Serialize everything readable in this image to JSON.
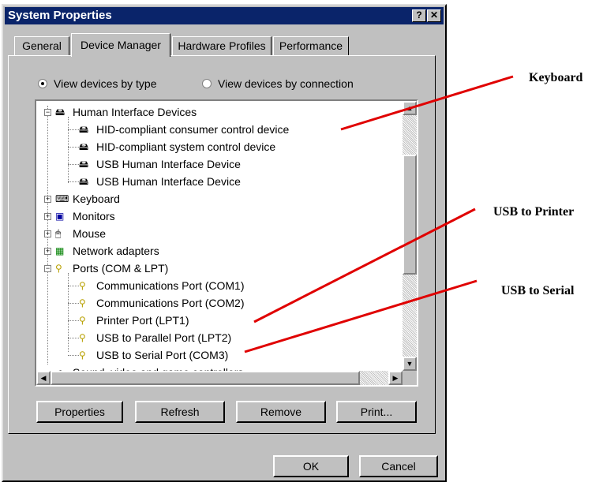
{
  "window": {
    "title": "System Properties",
    "help_label": "?",
    "close_label": "✕"
  },
  "tabs": [
    {
      "label": "General"
    },
    {
      "label": "Device Manager"
    },
    {
      "label": "Hardware Profiles"
    },
    {
      "label": "Performance"
    }
  ],
  "view_options": {
    "by_type": "View devices by type",
    "by_connection": "View devices by connection",
    "selected": "by_type"
  },
  "tree": {
    "hid": {
      "label": "Human Interface Devices",
      "children": [
        "HID-compliant consumer control device",
        "HID-compliant system control device",
        "USB Human Interface Device",
        "USB Human Interface Device"
      ]
    },
    "keyboard": "Keyboard",
    "monitors": "Monitors",
    "mouse": "Mouse",
    "network": "Network adapters",
    "ports": {
      "label": "Ports (COM & LPT)",
      "children": [
        "Communications Port (COM1)",
        "Communications Port (COM2)",
        "Printer Port (LPT1)",
        "USB to Parallel Port (LPT2)",
        "USB to Serial Port (COM3)"
      ]
    },
    "sound": "Sound, video and game controllers"
  },
  "buttons": {
    "properties": "Properties",
    "refresh": "Refresh",
    "remove": "Remove",
    "print": "Print...",
    "ok": "OK",
    "cancel": "Cancel"
  },
  "callouts": {
    "keyboard": "Keyboard",
    "usb_printer": "USB to Printer",
    "usb_serial": "USB to Serial"
  },
  "colors": {
    "title_bar": "#0a246a",
    "face": "#c0c0c0",
    "callout_line": "#e00000"
  }
}
